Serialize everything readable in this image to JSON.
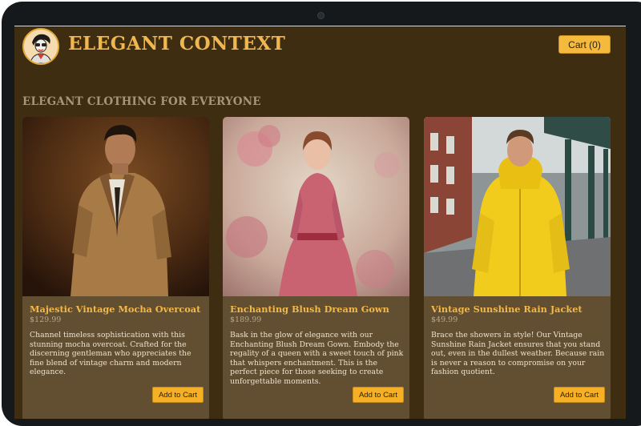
{
  "header": {
    "title": "ELEGANT CONTEXT",
    "cart_label": "Cart (0)"
  },
  "main": {
    "heading": "ELEGANT CLOTHING FOR EVERYONE"
  },
  "products": [
    {
      "title": "Majestic Vintage Mocha Overcoat",
      "price": "$129.99",
      "description": "Channel timeless sophistication with this stunning mocha overcoat. Crafted for the discerning gentleman who appreciates the fine blend of vintage charm and modern elegance.",
      "button": "Add to Cart"
    },
    {
      "title": "Enchanting Blush Dream Gown",
      "price": "$189.99",
      "description": "Bask in the glow of elegance with our Enchanting Blush Dream Gown. Embody the regality of a queen with a sweet touch of pink that whispers enchantment. This is the perfect piece for those seeking to create unforgettable moments.",
      "button": "Add to Cart"
    },
    {
      "title": "Vintage Sunshine Rain Jacket",
      "price": "$49.99",
      "description": "Brace the showers in style! Our Vintage Sunshine Rain Jacket ensures that you stand out, even in the dullest weather. Because rain is never a reason to compromise on your fashion quotient.",
      "button": "Add to Cart"
    }
  ],
  "colors": {
    "background": "#3e2d10",
    "card": "#624e30",
    "accent": "#f0b650",
    "button": "#f5b025"
  }
}
